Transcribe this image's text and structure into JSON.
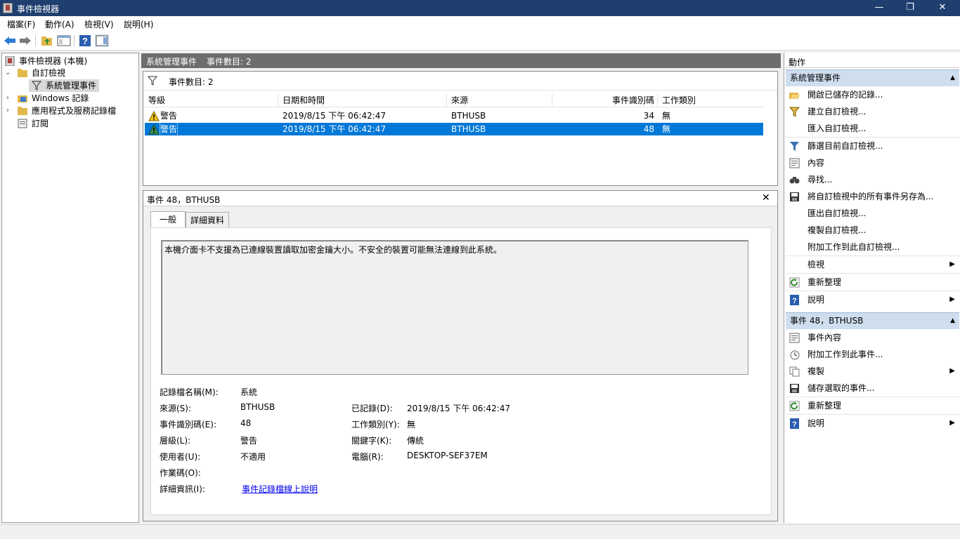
{
  "window": {
    "title": "事件檢視器",
    "minimize": "—",
    "maximize": "❐",
    "close": "✕"
  },
  "menu": [
    "檔案(F)",
    "動作(A)",
    "檢視(V)",
    "說明(H)"
  ],
  "tree": {
    "root": "事件檢視器 (本機)",
    "custom_views": "自訂檢視",
    "admin_events": "系統管理事件",
    "windows_logs": "Windows 記錄",
    "app_logs": "應用程式及服務記錄檔",
    "subscriptions": "訂閱"
  },
  "center": {
    "header_title": "系統管理事件",
    "header_count": "事件數目: 2",
    "filter_text": "事件數目: 2",
    "columns": [
      "等級",
      "日期和時間",
      "來源",
      "事件識別碼",
      "工作類別"
    ],
    "rows": [
      {
        "level": "警告",
        "datetime": "2019/8/15 下午 06:42:47",
        "source": "BTHUSB",
        "event_id": "34",
        "task": "無",
        "selected": false
      },
      {
        "level": "警告",
        "datetime": "2019/8/15 下午 06:42:47",
        "source": "BTHUSB",
        "event_id": "48",
        "task": "無",
        "selected": true
      }
    ]
  },
  "detail": {
    "title": "事件 48，BTHUSB",
    "tabs": [
      "一般",
      "詳細資料"
    ],
    "message": "本機介面卡不支援為已連線裝置讀取加密金鑰大小。不安全的裝置可能無法連線到此系統。",
    "fields": {
      "log_name_label": "記錄檔名稱(M):",
      "log_name": "系統",
      "source_label": "來源(S):",
      "source": "BTHUSB",
      "logged_label": "已記錄(D):",
      "logged": "2019/8/15 下午 06:42:47",
      "event_id_label": "事件識別碼(E):",
      "event_id": "48",
      "task_label": "工作類別(Y):",
      "task": "無",
      "level_label": "層級(L):",
      "level": "警告",
      "keywords_label": "關鍵字(K):",
      "keywords": "傳統",
      "user_label": "使用者(U):",
      "user": "不適用",
      "computer_label": "電腦(R):",
      "computer": "DESKTOP-SEF37EM",
      "opcode_label": "作業碼(O):",
      "more_info_label": "詳細資訊(I):",
      "more_info_link": "事件記錄檔線上說明"
    }
  },
  "actions": {
    "title": "動作",
    "group1": "系統管理事件",
    "group1_items": [
      "開啟已儲存的記錄...",
      "建立自訂檢視...",
      "匯入自訂檢視...",
      "篩選目前自訂檢視...",
      "內容",
      "尋找...",
      "將自訂檢視中的所有事件另存為...",
      "匯出自訂檢視...",
      "複製自訂檢視...",
      "附加工作到此自訂檢視...",
      "檢視",
      "重新整理",
      "說明"
    ],
    "group2": "事件 48，BTHUSB",
    "group2_items": [
      "事件內容",
      "附加工作到此事件...",
      "複製",
      "儲存選取的事件...",
      "重新整理",
      "說明"
    ]
  },
  "colors": {
    "titlebar": "#1f3f6f",
    "selection": "#0078d7",
    "group_header": "#cfdeee",
    "header_bar": "#6d6d6d",
    "link": "#0000ee"
  }
}
